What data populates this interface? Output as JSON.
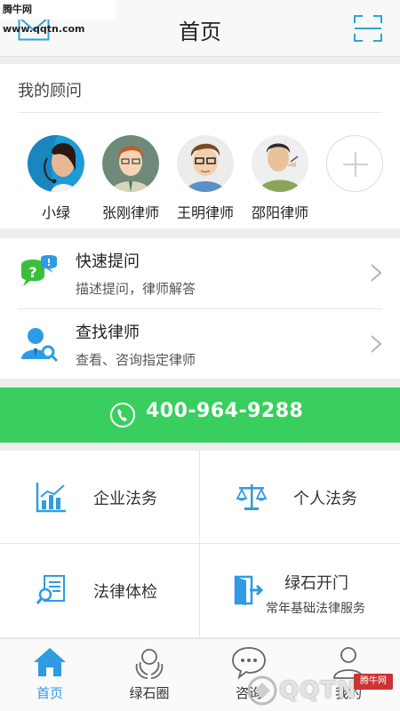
{
  "watermark_top": "腾牛网 www.qqtn.com",
  "header": {
    "title": "首页"
  },
  "advisors": {
    "label": "我的顾问",
    "items": [
      {
        "name": "小绿"
      },
      {
        "name": "张刚律师"
      },
      {
        "name": "王明律师"
      },
      {
        "name": "邵阳律师"
      }
    ]
  },
  "menu": [
    {
      "title": "快速提问",
      "subtitle": "描述提问，律师解答"
    },
    {
      "title": "查找律师",
      "subtitle": "查看、咨询指定律师"
    }
  ],
  "phone": {
    "number": "400-964-9288"
  },
  "grid": [
    {
      "label": "企业法务"
    },
    {
      "label": "个人法务"
    },
    {
      "label": "法律体检"
    },
    {
      "label": "绿石开门",
      "subtitle": "常年基础法律服务"
    }
  ],
  "tabs": [
    {
      "label": "首页",
      "active": true
    },
    {
      "label": "绿石圈"
    },
    {
      "label": "咨询"
    },
    {
      "label": "我的"
    }
  ],
  "watermark_bottom": {
    "text": "QQTN",
    "badge": "腾牛网"
  },
  "colors": {
    "accent": "#2f9be5",
    "phone_bar": "#38cf5e",
    "menu_icon_green": "#3bbf3b"
  }
}
